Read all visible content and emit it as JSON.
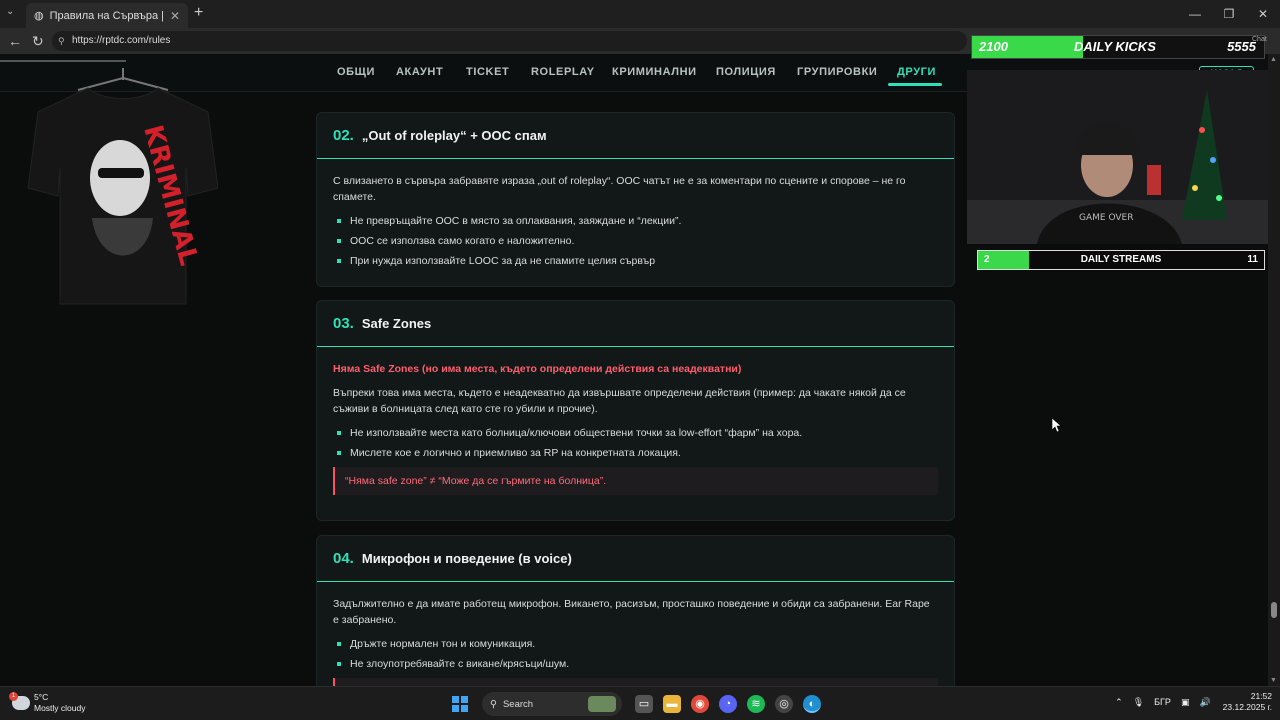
{
  "browser": {
    "tab_title": "Правила на Сървъра | TDC Roleplay",
    "tab_close": "✕",
    "new_tab": "+",
    "url": "https://rptdc.com/rules",
    "window_controls": [
      "—",
      "❐",
      "✕"
    ]
  },
  "nav": {
    "items": [
      "ОБЩИ",
      "АКАУНТ",
      "TICKET",
      "ROLEPLAY",
      "КРИМИНАЛНИ",
      "ПОЛИЦИЯ",
      "ГРУПИРОВКИ",
      "ДРУГИ"
    ],
    "active": "ДРУГИ",
    "back_button": "НАЗАД"
  },
  "shirt": {
    "print_text": "KRIMINAL"
  },
  "sections": [
    {
      "number": "02.",
      "title": "„Out of roleplay“ + OOC спам",
      "intro": "С влизането в сървъра забравяте израза „out of roleplay“. OOC чатът не е за коментари по сцените и спорове – не го спамете.",
      "bullets": [
        "Не превръщайте OOC в място за оплаквания, заяждане и “лекции”.",
        "OOC се използва само когато е наложително.",
        "При нужда използвайте LOOC за да не спамите целия сървър"
      ]
    },
    {
      "number": "03.",
      "title": "Safe Zones",
      "warning_title": "Няма Safe Zones (но има места, където определени действия са неадекватни)",
      "intro": "Въпреки това има места, където е неадекватно да извършвате определени действия (пример: да чакате някой да се съживи в болницата след като сте го убили и прочие).",
      "bullets": [
        "Не използвайте места като болница/ключови обществени точки за low-effort “фарм” на хора.",
        "Мислете кое е логично и приемливо за RP на конкретната локация."
      ],
      "callout": "“Няма safe zone” ≠ “Може да се гърмите на болница”."
    },
    {
      "number": "04.",
      "title": "Микрофон и поведение (в voice)",
      "intro": "Задължително е да имате работещ микрофон. Викането, расизъм, просташко поведение и обиди са забранени. Ear Rape е забранено.",
      "bullets": [
        "Дръжте нормален тон и комуникация.",
        "Не злоупотребявайте с викане/крясъци/шум."
      ]
    }
  ],
  "overlay": {
    "kicks": {
      "current": "2100",
      "label": "DAILY KICKS",
      "goal": "5555",
      "progress": 0.38
    },
    "streams": {
      "current": "2",
      "label": "DAILY STREAMS",
      "goal": "11",
      "progress": 0.18
    },
    "chat_label": "Chat",
    "webcam_shirt_text": "GAME OVER"
  },
  "taskbar": {
    "weather_temp": "5°C",
    "weather_desc": "Mostly cloudy",
    "weather_badge": "1",
    "search_label": "Search",
    "language": "БГР",
    "time": "21:52",
    "date": "23.12.2025 г."
  }
}
